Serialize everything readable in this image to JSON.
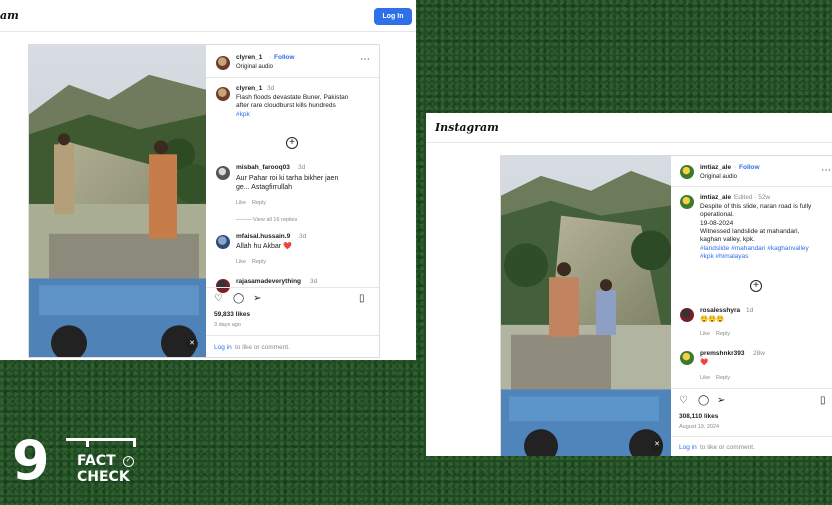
{
  "left_post": {
    "logo_fragment": "am",
    "login_button": "Log In",
    "author": "clyren_1",
    "follow": "Follow",
    "audio": "Original audio",
    "caption_user": "clyren_1",
    "caption_time": "3d",
    "caption_lines": [
      "Flash floods devastate Buner, Pakistan",
      "after rare cloudburst kills hundreds",
      "#kpk"
    ],
    "comments": [
      {
        "user": "misbah_farooq03",
        "time": "3d",
        "lines": [
          "Aur Pahar roi ki tarha bikher jaen",
          "ge... Astagfirrullah"
        ],
        "like": "Like",
        "reply": "Reply"
      },
      {
        "user": "mfaisal.hussain.9",
        "time": "3d",
        "lines": [
          "Allah hu Akbar ❤️"
        ],
        "like": "Like",
        "reply": "Reply"
      },
      {
        "user": "rajasamadeverything",
        "time": "3d",
        "lines": []
      }
    ],
    "view_replies": "View all 16 replies",
    "likes": "59,833 likes",
    "date": "3 days ago",
    "login_prompt_link": "Log in",
    "login_prompt_rest": " to like or comment."
  },
  "right_post": {
    "logo": "Instagram",
    "author": "imtiaz_ale",
    "follow": "Follow",
    "audio": "Original audio",
    "caption_user": "imtiaz_ale",
    "caption_meta": "Edited · 52w",
    "caption_lines": [
      "Despite of this slide, naran road is fully",
      "operational.",
      "19-08-2024",
      "Witnessed landslide at mahandari,",
      "kaghan valley, kpk."
    ],
    "hashtags": [
      "#landslide #mahandari #kaghanvalley",
      "#kpk #himalayas"
    ],
    "comments": [
      {
        "user": "rosalesshyra",
        "time": "1d",
        "text": "😲😲😲",
        "like": "Like",
        "reply": "Reply"
      },
      {
        "user": "premshnkr393",
        "time": "28w",
        "text": "❤️",
        "like": "Like",
        "reply": "Reply"
      }
    ],
    "likes": "308,110 likes",
    "date": "August 19, 2024",
    "login_prompt_link": "Log in",
    "login_prompt_rest": " to like or comment."
  },
  "brand": {
    "nine": "9",
    "fact": "FACT",
    "check": "CHECK"
  },
  "icons": [
    "more-icon",
    "add-comment-icon",
    "heart-icon",
    "comment-icon",
    "share-icon",
    "bookmark-icon",
    "muted-icon"
  ],
  "colors": {
    "background": "#1f4a23",
    "accent": "#2f6fe8"
  }
}
